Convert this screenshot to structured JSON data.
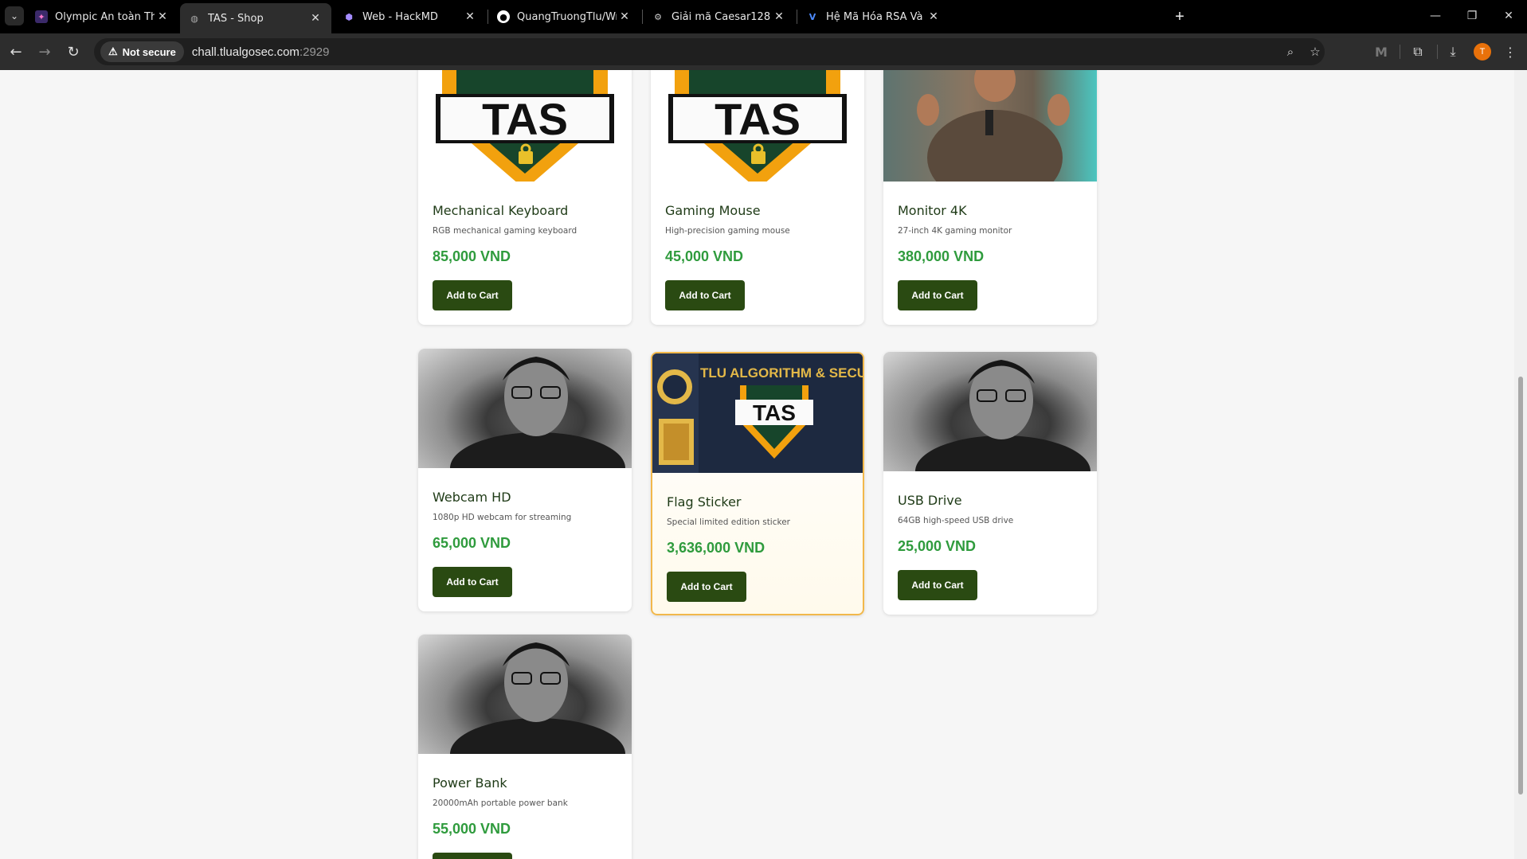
{
  "browser": {
    "tabs": [
      {
        "title": "Olympic An toàn Thông tin cấp",
        "icon": "olympic-logo-icon"
      },
      {
        "title": "TAS - Shop",
        "icon": "globe-icon"
      },
      {
        "title": "Web - HackMD",
        "icon": "hackmd-icon"
      },
      {
        "title": "QuangTruongTlu/WriteUp: A pl",
        "icon": "github-icon"
      },
      {
        "title": "Giải mã Caesar128",
        "icon": "gear-icon"
      },
      {
        "title": "Hệ Mã Hóa RSA Và Chữ Ký Số -",
        "icon": "v-logo-icon"
      }
    ],
    "security_label": "Not secure",
    "url_host": "chall.tlualgosec.com",
    "url_port": ":2929",
    "profile_initial": "T"
  },
  "shop": {
    "button_label": "Add to Cart",
    "products": [
      {
        "name": "Mechanical Keyboard",
        "description": "RGB mechanical gaming keyboard",
        "price": "85,000 VND",
        "image": "tas-logo"
      },
      {
        "name": "Gaming Mouse",
        "description": "High-precision gaming mouse",
        "price": "45,000 VND",
        "image": "tas-logo"
      },
      {
        "name": "Monitor 4K",
        "description": "27-inch 4K gaming monitor",
        "price": "380,000 VND",
        "image": "photo"
      },
      {
        "name": "Webcam HD",
        "description": "1080p HD webcam for streaming",
        "price": "65,000 VND",
        "image": "portrait"
      },
      {
        "name": "Flag Sticker",
        "description": "Special limited edition sticker",
        "price": "3,636,000 VND",
        "image": "banner"
      },
      {
        "name": "USB Drive",
        "description": "64GB high-speed USB drive",
        "price": "25,000 VND",
        "image": "portrait"
      },
      {
        "name": "Power Bank",
        "description": "20000mAh portable power bank",
        "price": "55,000 VND",
        "image": "portrait"
      }
    ],
    "banner_text": "TLU ALGORITHM & SECU",
    "logo_text": "TAS"
  },
  "colors": {
    "price": "#2f9b3d",
    "button": "#2a4a12",
    "special_border": "#f2b84b"
  }
}
